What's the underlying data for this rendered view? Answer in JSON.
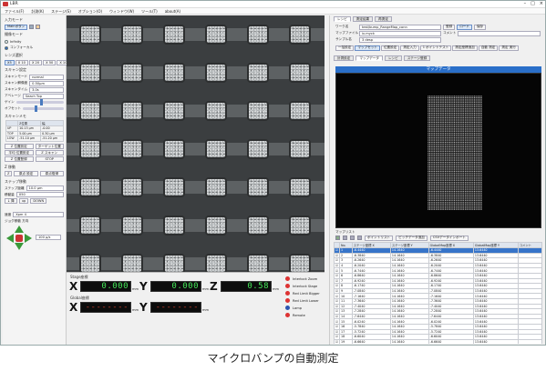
{
  "app": {
    "title": "LBR"
  },
  "menu": [
    "ファイル(F)",
    "計測(K)",
    "ステージ(S)",
    "オプション(O)",
    "ウィンドウ(W)",
    "ツール(T)",
    "about(A)"
  ],
  "left": {
    "main_toggle": "Mainボタン",
    "groups": {
      "input_mode": "入力モード",
      "scan_mode": "撮像モード",
      "lens": "レンズ選択",
      "scan_settings": "スキャン設定",
      "scan_memo": "スキャンメモ",
      "z_move": "Z 移動",
      "step_move": "ステップ移動",
      "speed": "速度",
      "jog": "ジョグ移動 方向"
    },
    "scan_modes": [
      "Infinity",
      "コンフォーカル"
    ],
    "lens_buttons": [
      "X5",
      "X 10",
      "X 20",
      "X 50",
      "X 100"
    ],
    "scan_rows": [
      {
        "label": "スキャンモード",
        "value": "normal"
      },
      {
        "label": "スキャン解像度",
        "value": "0.50µm"
      },
      {
        "label": "スキャンタイム",
        "value": "3.0s"
      },
      {
        "label": "アベレージ",
        "value": "Seach Top"
      }
    ],
    "sliders": [
      {
        "label": "ゲイン",
        "pos": 0.5
      },
      {
        "label": "オフセット",
        "pos": 0.3
      }
    ],
    "scan_table": {
      "headers": [
        "",
        "Z位置",
        "幅"
      ],
      "rows": [
        [
          "UP",
          "10.13 µm",
          "-0.00"
        ],
        [
          "TOP",
          "5.00 µm",
          "0.30 µm"
        ],
        [
          "LOW",
          "-51.10 µm",
          "-51.20 µm"
        ]
      ]
    },
    "buttons_a": [
      "Z 位置設定",
      "ターゲット位置"
    ],
    "buttons_b": [
      "平均 位置設定",
      "Z スキャン"
    ],
    "buttons_c": [
      "Z 位置登録",
      "STOP"
    ],
    "z_buttons": [
      "Z",
      "原点 設定",
      "原点復帰"
    ],
    "step_rows": [
      {
        "label": "ステップ距離",
        "value": "10.0 µm"
      },
      {
        "label": "移動量",
        "value": "X50"
      }
    ],
    "step_buttons": [
      "↓ 降",
      "up",
      "DOWN"
    ],
    "speed_value": "Xpm 4",
    "jog_value": "100 µ/s"
  },
  "readout": {
    "stage_label": "Stage座標",
    "global_label": "Global座標",
    "axes": [
      "X",
      "Y",
      "Z"
    ],
    "stage_values": [
      "0.000",
      "0.000",
      "0.58"
    ],
    "global_values": [
      "--------",
      "--------"
    ],
    "unit": "mm",
    "status": [
      {
        "label": "Interlock Zoom",
        "color": "#d33"
      },
      {
        "label": "Interlock Stage",
        "color": "#d33"
      },
      {
        "label": "Red Limit Bigger",
        "color": "#d33"
      },
      {
        "label": "Red Limit Lower",
        "color": "#d33"
      },
      {
        "label": "Lamp",
        "color": "#2d55b0"
      },
      {
        "label": "Remote",
        "color": "#d33"
      }
    ]
  },
  "right": {
    "top_tabs": [
      "レシピ",
      "測定結果",
      "再測定"
    ],
    "recipe_rows": [
      {
        "label": "ワーク名",
        "value": "test/bump_RangeMap_conn"
      },
      {
        "label": "マップファイル",
        "value": "ix.myck"
      },
      {
        "label": "サンプル名",
        "value": "3 desp"
      }
    ],
    "recipe_buttons": [
      "登録",
      "ロード",
      "保存"
    ],
    "comment_label": "コメント",
    "toolbar_row1": [
      "一括設定",
      "マップセット",
      "位置設定",
      "測定入力",
      "1 ポイントテスト"
    ],
    "toolbar_row2": [
      "測定座標追加",
      "自動 測定",
      "測定 実行"
    ],
    "map_tabs": [
      "計測設定",
      "マップデータ",
      "レシピ",
      "ステージ登録"
    ],
    "map_title": "マップデータ",
    "list_label": "マップリスト",
    "list_toolbar": [
      "ポイントリスト",
      "ピッチデータ追加",
      "CSVデータインポート"
    ],
    "table_headers": [
      "",
      "No.",
      "ステージ座標 X",
      "ステージ座標 Y",
      "GlobalMap座標 X",
      "GlobalMap座標 Y",
      "コメント"
    ],
    "rows": [
      [
        "1",
        "-6.4440",
        "14.1640",
        "-6.4440",
        "13.6440"
      ],
      [
        "2",
        "-6.3840",
        "14.1640",
        "-6.3840",
        "13.6440"
      ],
      [
        "3",
        "-6.2640",
        "14.1640",
        "-6.2640",
        "13.6440"
      ],
      [
        "4",
        "-6.2040",
        "14.1640",
        "-6.2040",
        "13.6440"
      ],
      [
        "5",
        "-6.7440",
        "14.1640",
        "-6.7440",
        "13.6440"
      ],
      [
        "6",
        "-6.8640",
        "14.1640",
        "-6.8640",
        "13.6440"
      ],
      [
        "7",
        "-6.9240",
        "14.1640",
        "-6.9240",
        "13.6440"
      ],
      [
        "8",
        "-6.1740",
        "14.1640",
        "-6.1740",
        "13.6440"
      ],
      [
        "9",
        "-7.0840",
        "14.1640",
        "-7.0840",
        "13.6440"
      ],
      [
        "10",
        "-7.1640",
        "14.1640",
        "-7.1640",
        "13.6440"
      ],
      [
        "11",
        "-7.3640",
        "14.1640",
        "-7.3640",
        "13.6440"
      ],
      [
        "12",
        "-7.4040",
        "14.1640",
        "-7.4040",
        "13.6440"
      ],
      [
        "13",
        "-7.2840",
        "14.1640",
        "-7.2840",
        "13.6440"
      ],
      [
        "14",
        "-7.6440",
        "14.1640",
        "-7.6440",
        "13.6440"
      ],
      [
        "15",
        "-6.0240",
        "14.1640",
        "-6.0240",
        "13.6440"
      ],
      [
        "16",
        "-5.7840",
        "14.1640",
        "-5.7840",
        "13.6440"
      ],
      [
        "17",
        "-5.7240",
        "14.1640",
        "-5.7240",
        "13.6440"
      ],
      [
        "18",
        "-6.6040",
        "14.1640",
        "-6.6040",
        "13.6440"
      ],
      [
        "19",
        "-6.6640",
        "14.1640",
        "-6.6640",
        "13.6440"
      ],
      [
        "20",
        "-6.5240",
        "14.1640",
        "-6.5240",
        "13.6440"
      ]
    ]
  },
  "caption": "マイクロバンプの自動測定",
  "colors": {
    "accent": "#2a6fc9",
    "selected_row": "#3674c9",
    "digit_green": "#46e85a",
    "digit_red": "#c13b2b"
  }
}
